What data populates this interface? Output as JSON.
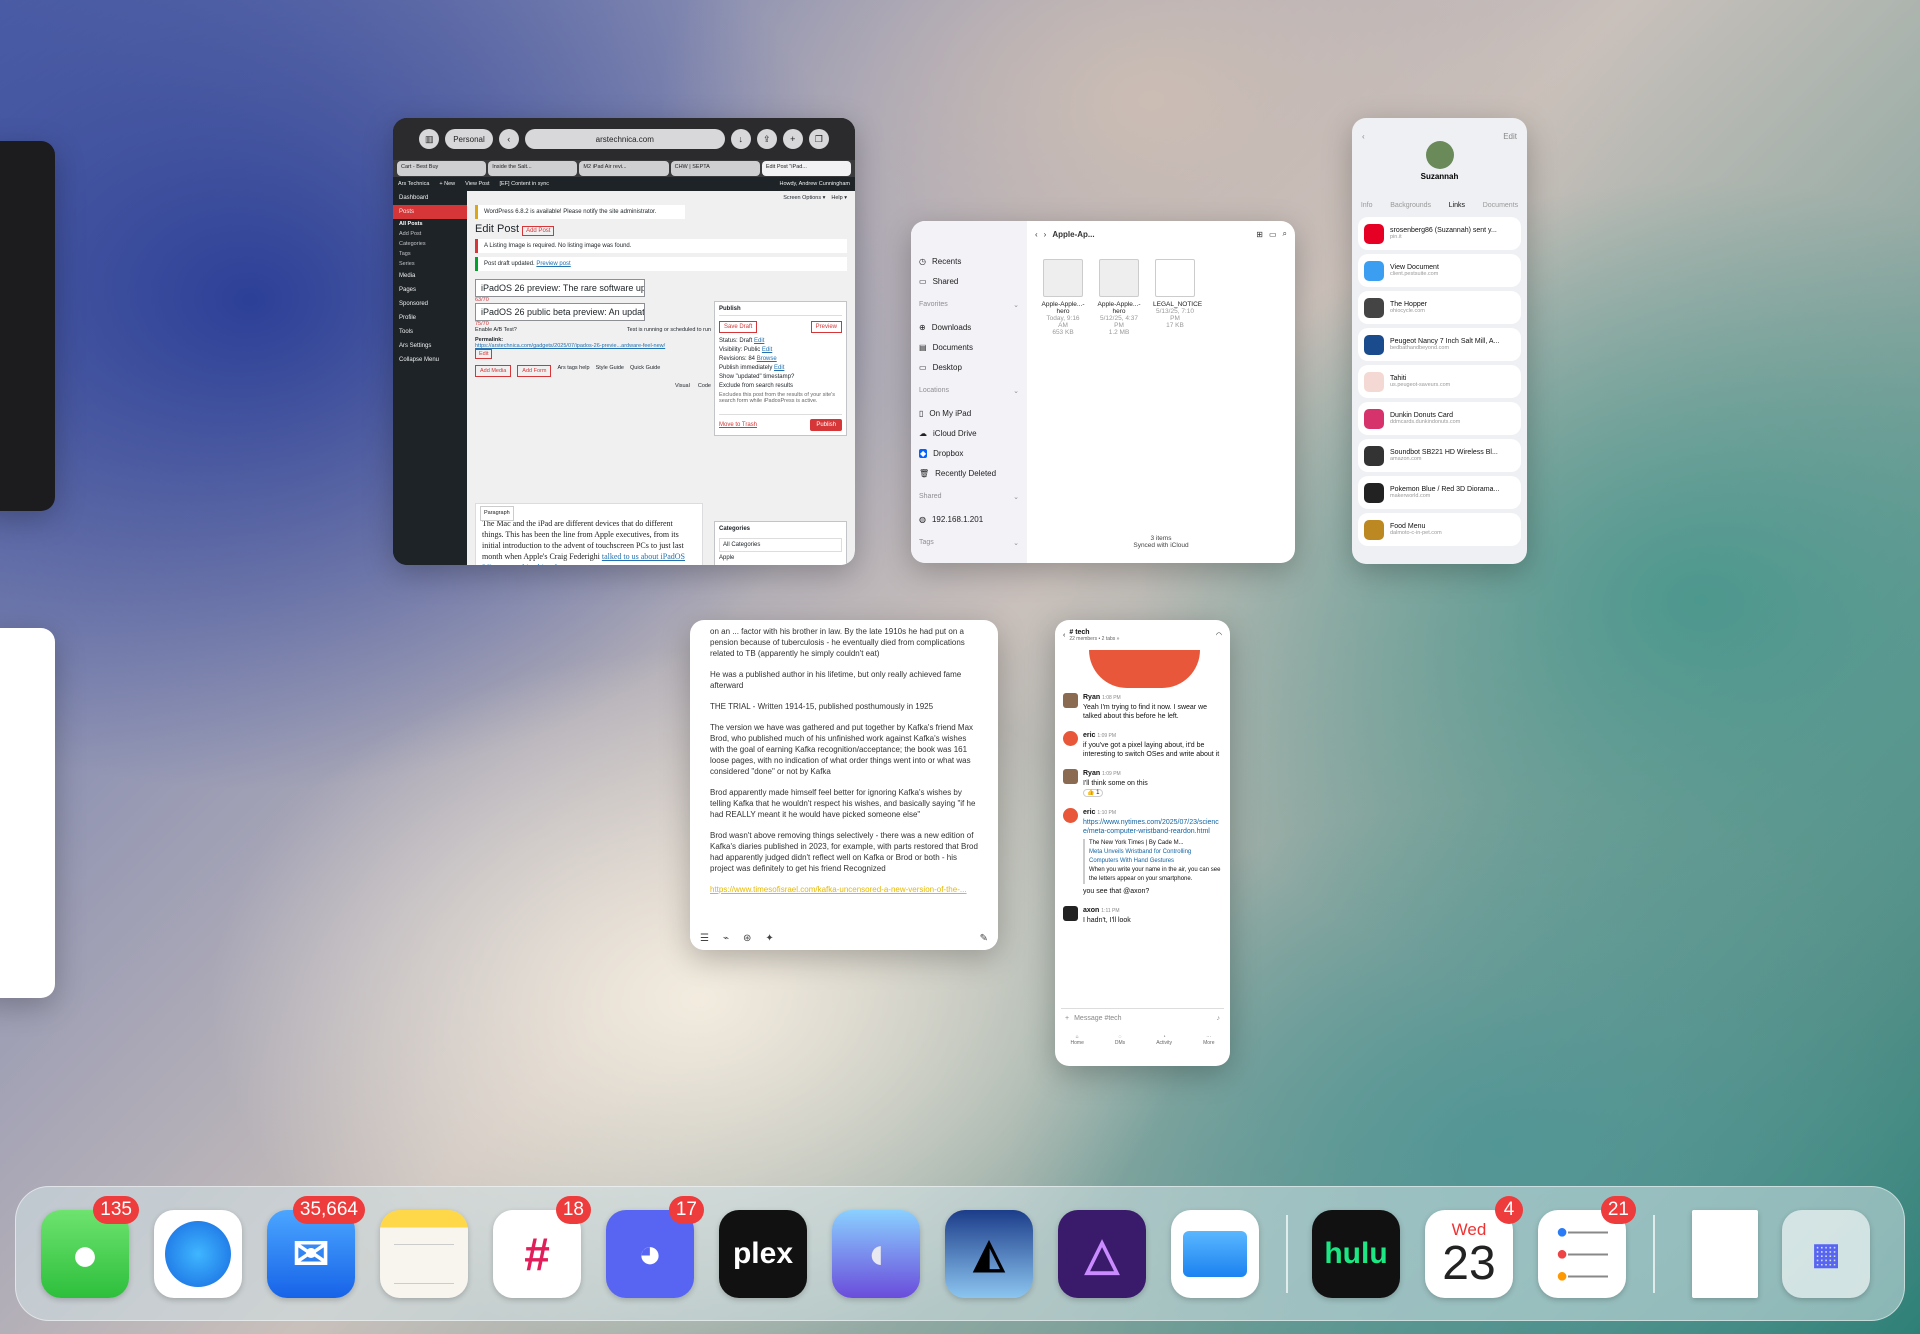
{
  "safari": {
    "tab_group": "Personal",
    "url": "arstechnica.com",
    "tabs": [
      "Cart - Best Buy",
      "Inside the Salt...",
      "M2 iPad Air revi...",
      "CHW | SEPTA",
      "Edit Post \"iPad..."
    ]
  },
  "wp": {
    "adminbar": [
      "Ars Technica",
      "+ New",
      "View Post",
      "[EF] Content in sync"
    ],
    "howdy": "Howdy, Andrew Cunningham",
    "screen_options": "Screen Options ▾",
    "help": "Help ▾",
    "menu": [
      "Dashboard",
      "Posts",
      "All Posts",
      "Add Post",
      "Categories",
      "Tags",
      "Series",
      "Media",
      "Pages",
      "Sponsored",
      "Profile",
      "Tools",
      "Ars Settings",
      "Collapse Menu"
    ],
    "update_notice": "WordPress 6.8.2 is available! Please notify the site administrator.",
    "heading": "Edit Post",
    "add_post": "Add Post",
    "error_notice": "A Listing Image is required. No listing image was found.",
    "draft_notice": "Post draft updated.",
    "preview_link": "Preview post",
    "title1": "iPadOS 26 preview: The rare software up",
    "count1": "63/70",
    "title2": "iPadOS 26 public beta preview: An updat",
    "count2": "75/70",
    "ab_label": "Enable A/B Test?",
    "ab_status": "Test is running or scheduled to run",
    "permalink_label": "Permalink:",
    "permalink": "https://arstechnica.com/gadgets/2025/07/ipados-26-previe...ardware-feel-new/",
    "edit": "Edit",
    "add_media": "Add Media",
    "add_form": "Add Form",
    "tag_help": "Ars tags help",
    "style_guide": "Style Guide",
    "quick_guide": "Quick Guide",
    "visual": "Visual",
    "code": "Code",
    "paragraph": "Paragraph",
    "body": "The Mac and the iPad are different devices that do different things. This has been the line from Apple executives, from its initial introduction to the advent of touchscreen PCs to just last month when Apple's Craig Federighi",
    "body_link": "talked to us about iPadOS 26's new multitasking features.",
    "publish": {
      "title": "Publish",
      "save_draft": "Save Draft",
      "preview": "Preview",
      "status": "Status: Draft",
      "visibility": "Visibility: Public",
      "revisions": "Revisions: 84",
      "revisions_link": "Browse",
      "publish_when": "Publish immediately",
      "show_updated": "Show \"updated\" timestamp?",
      "exclude": "Exclude from search results",
      "exclude_note": "Excludes this post from the results of your site's search form while iPadosPress is active.",
      "trash": "Move to Trash",
      "button": "Publish"
    },
    "categories": {
      "title": "Categories",
      "all": "All Categories",
      "item": "Apple"
    }
  },
  "files": {
    "sidebar": {
      "recents": "Recents",
      "shared": "Shared",
      "favorites": "Favorites",
      "downloads": "Downloads",
      "documents": "Documents",
      "desktop": "Desktop",
      "locations": "Locations",
      "on_my_ipad": "On My iPad",
      "icloud": "iCloud Drive",
      "dropbox": "Dropbox",
      "deleted": "Recently Deleted",
      "shared_hd": "Shared",
      "server": "192.168.1.201",
      "tags": "Tags"
    },
    "folder": "Apple-Ap...",
    "items": [
      {
        "name": "Apple-Apple...-hero",
        "date": "Today, 9:16 AM",
        "size": "653 KB"
      },
      {
        "name": "Apple-Apple...-hero",
        "date": "5/12/25, 4:37 PM",
        "size": "1.2 MB"
      },
      {
        "name": "LEGAL_NOTICE",
        "date": "5/13/25, 7:10 PM",
        "size": "17 KB"
      }
    ],
    "count": "3 items",
    "sync": "Synced with iCloud"
  },
  "contact": {
    "name": "Suzannah",
    "edit": "Edit",
    "tabs": [
      "Info",
      "Backgrounds",
      "Links",
      "Documents"
    ],
    "rows": [
      {
        "title": "srosenberg86 (Suzannah) sent y...",
        "sub": "pin.it",
        "color": "#e60023"
      },
      {
        "title": "View Document",
        "sub": "client.pestsuite.com",
        "color": "#3b9ef0"
      },
      {
        "title": "The Hopper",
        "sub": "ohiocycle.com",
        "color": "#444"
      },
      {
        "title": "Peugeot Nancy 7 Inch Salt Mill, A...",
        "sub": "bedbathandbeyond.com",
        "color": "#1a4b8c"
      },
      {
        "title": "Tahiti",
        "sub": "us.peugeot-saveurs.com",
        "color": "#f3d8d3"
      },
      {
        "title": "Dunkin Donuts Card",
        "sub": "ddmcards.dunkindonuts.com",
        "color": "#d6336c"
      },
      {
        "title": "Soundbot SB221 HD Wireless Bl...",
        "sub": "amazon.com",
        "color": "#333"
      },
      {
        "title": "Pokemon Blue / Red 3D Diorama...",
        "sub": "makerworld.com",
        "color": "#222"
      },
      {
        "title": "Food Menu",
        "sub": "dalmoto-c-in-pet.com",
        "color": "#b82"
      }
    ]
  },
  "notes": {
    "paragraphs": [
      "on an ... factor with his brother in law. By the late 1910s he had put on a pension because of tuberculosis - he eventually died from complications related to TB (apparently he simply couldn't eat)",
      "He was a published author in his lifetime, but only really achieved fame afterward",
      "THE TRIAL - Written 1914-15, published posthumously in 1925",
      "The version we have was gathered and put together by Kafka's friend Max Brod, who published much of his unfinished work against Kafka's wishes with the goal of earning Kafka recognition/acceptance; the book was 161 loose pages, with no indication of what order things went into or what was considered \"done\" or not by Kafka",
      "Brod apparently made himself feel better for ignoring Kafka's wishes by telling Kafka that he wouldn't respect his wishes, and basically saying \"if he had REALLY meant it he would have picked someone else\"",
      "Brod wasn't above removing things selectively - there was a new edition of Kafka's diaries published in 2023, for example, with parts restored that Brod had apparently judged didn't reflect well on Kafka or Brod or both - his project was definitely to get his friend Recognized"
    ],
    "link": "https://www.timesofisrael.com/kafka-uncensored-a-new-version-of-the-..."
  },
  "slack": {
    "channel": "tech",
    "members": "22 members • 2 tabs »",
    "messages": [
      {
        "user": "Ryan",
        "time": "1:08 PM",
        "text": "Yeah I'm trying to find it now. I swear we talked about this before he left."
      },
      {
        "user": "eric",
        "time": "1:09 PM",
        "text": "if you've got a pixel laying about, it'd be interesting to switch OSes and write about it"
      },
      {
        "user": "Ryan",
        "time": "1:09 PM",
        "text": "I'll think some on this"
      },
      {
        "user": "eric",
        "time": "1:10 PM",
        "text": "https://www.nytimes.com/2025/07/23/science/meta-computer-wristband-reardon.html"
      },
      {
        "user": "axon",
        "time": "1:11 PM",
        "text": "I hadn't, I'll look"
      }
    ],
    "reaction": "👍 1",
    "preview_src": "The New York Times | By Cade M...",
    "preview_title": "Meta Unveils Wristband for Controlling Computers With Hand Gestures",
    "preview_desc": "When you write your name in the air, you can see the letters appear on your smartphone.",
    "see_that": "you see that @axon?",
    "input": "Message #tech",
    "nav": [
      "Home",
      "DMs",
      "Activity",
      "More"
    ]
  },
  "dock": {
    "apps": [
      {
        "name": "Messages",
        "badge": "135"
      },
      {
        "name": "Safari",
        "badge": ""
      },
      {
        "name": "Mail",
        "badge": "35,664"
      },
      {
        "name": "Notes",
        "badge": ""
      },
      {
        "name": "Slack",
        "badge": "18"
      },
      {
        "name": "Discord",
        "badge": "17"
      },
      {
        "name": "plex",
        "badge": ""
      },
      {
        "name": "Mastodon",
        "badge": ""
      },
      {
        "name": "Kindle",
        "badge": ""
      },
      {
        "name": "Affinity Photo",
        "badge": ""
      },
      {
        "name": "Files",
        "badge": ""
      },
      {
        "name": "hulu",
        "badge": ""
      },
      {
        "name": "Calendar",
        "badge": "4"
      },
      {
        "name": "Reminders",
        "badge": "21"
      }
    ],
    "calendar_day": "Wed",
    "calendar_date": "23"
  }
}
